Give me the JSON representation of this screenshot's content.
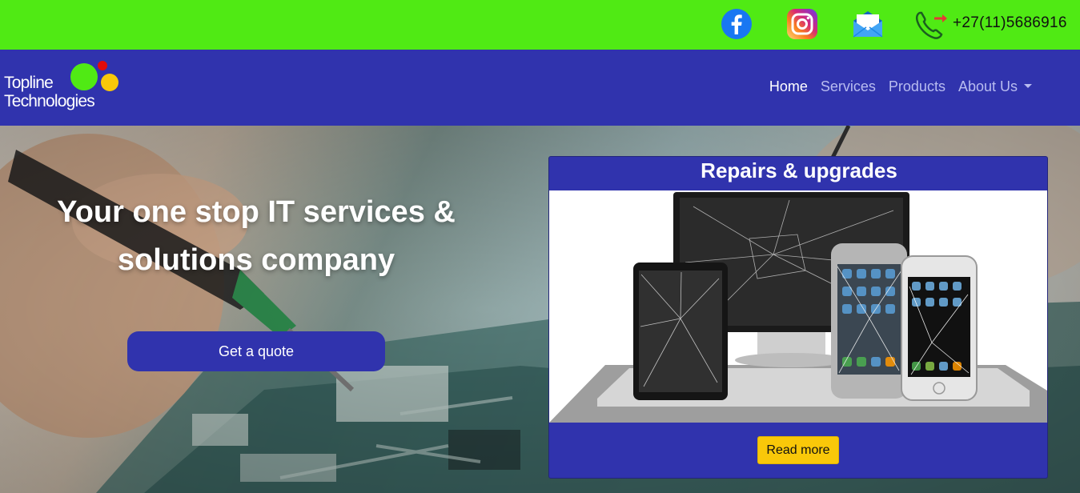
{
  "topbar": {
    "social": [
      {
        "name": "facebook-icon",
        "color": "#1877f2"
      },
      {
        "name": "instagram-icon",
        "color": "#d62976"
      },
      {
        "name": "email-icon",
        "color": "#1e88e5"
      }
    ],
    "phone_icon": "phone-icon",
    "phone_number": "+27(11)5686916",
    "bg_color": "#50ea14"
  },
  "navbar": {
    "brand_line1": "Topline",
    "brand_line2": "Technologies",
    "links": [
      {
        "label": "Home",
        "active": true
      },
      {
        "label": "Services",
        "active": false
      },
      {
        "label": "Products",
        "active": false
      },
      {
        "label": "About Us",
        "active": false,
        "dropdown": true
      }
    ],
    "bg_color": "#3033ad"
  },
  "hero": {
    "title": "Your one stop IT services & solutions company",
    "cta_label": "Get a quote"
  },
  "card": {
    "title": "Repairs & upgrades",
    "button_label": "Read more",
    "button_color": "#f9c809"
  }
}
